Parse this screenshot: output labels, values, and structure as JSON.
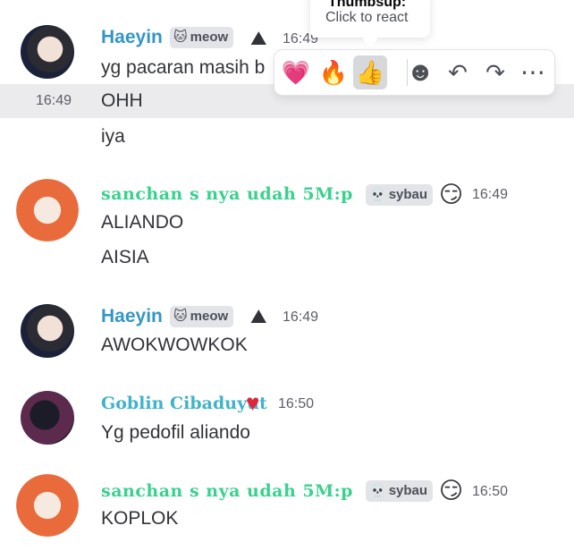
{
  "hover_time": "16:49",
  "tooltip": {
    "title": "Thumbsup:",
    "subtitle": "Click to react"
  },
  "toolbar": {
    "reactions": [
      {
        "name": "pink-heart",
        "glyph": "💗"
      },
      {
        "name": "fire",
        "glyph": "🔥"
      },
      {
        "name": "thumbsup",
        "glyph": "👍"
      }
    ],
    "actions": [
      {
        "name": "add-reaction-icon",
        "glyph": "☻"
      },
      {
        "name": "reply-icon",
        "glyph": "↶"
      },
      {
        "name": "forward-icon",
        "glyph": "↷"
      },
      {
        "name": "more-icon",
        "glyph": "⋯"
      }
    ]
  },
  "messages": [
    {
      "author": "Haeyin",
      "tag_icon": "🐱",
      "tag": "meow",
      "badge": "⛰",
      "time": "16:49",
      "lines": [
        "yg pacaran masih b",
        "OHH",
        "iya"
      ]
    },
    {
      "author": "sanchan s nya udah 5M:p",
      "tag_icon": "💀",
      "tag": "sybau",
      "badge": "😏",
      "time": "16:49",
      "lines": [
        "ALIANDO",
        "AISIA"
      ]
    },
    {
      "author": "Haeyin",
      "tag_icon": "🐱",
      "tag": "meow",
      "badge": "⛰",
      "time": "16:49",
      "lines": [
        "AWOKWOWKOK"
      ]
    },
    {
      "author": "Goblin Cibaduyut",
      "badge": "♥",
      "time": "16:50",
      "lines": [
        "Yg pedofil aliando"
      ]
    },
    {
      "author": "sanchan s nya udah 5M:p",
      "tag_icon": "💀",
      "tag": "sybau",
      "badge": "😏",
      "time": "16:50",
      "lines": [
        "KOPLOK"
      ]
    }
  ]
}
